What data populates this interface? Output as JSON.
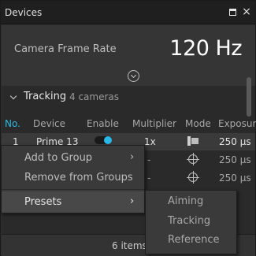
{
  "window": {
    "title": "Devices"
  },
  "frame_rate": {
    "label": "Camera Frame Rate",
    "value": "120 Hz"
  },
  "group": {
    "name": "Tracking",
    "count": "4 cameras"
  },
  "columns": [
    "No.",
    "Device",
    "Enable",
    "Multiplier",
    "Mode",
    "Exposure"
  ],
  "rows": [
    {
      "no": "1",
      "device": "Prime 13",
      "enabled": true,
      "multiplier": "1x",
      "mode": "grayscale-mode-icon",
      "exposure": "250 µs"
    },
    {
      "no": "",
      "device": "",
      "multiplier": "-",
      "mode": "crosshair-icon",
      "exposure": "250 µs"
    },
    {
      "no": "",
      "device": "",
      "multiplier": "-",
      "mode": "crosshair-icon",
      "exposure": "250 µs"
    }
  ],
  "footer": {
    "text": "6 items"
  },
  "context_menu": {
    "items": [
      {
        "label": "Add to Group",
        "submenu": true
      },
      {
        "label": "Remove from Groups",
        "submenu": false
      },
      {
        "label": "Presets",
        "submenu": true
      }
    ],
    "submenu_arrow": "›"
  },
  "presets_submenu": {
    "items": [
      "Aiming",
      "Tracking",
      "Reference"
    ]
  },
  "icons": {
    "restore": "restore-icon",
    "close": "×",
    "collapse": "chevron-down-circle-icon"
  },
  "colors": {
    "accent": "#29b8e8",
    "background": "#2a2a2a"
  }
}
